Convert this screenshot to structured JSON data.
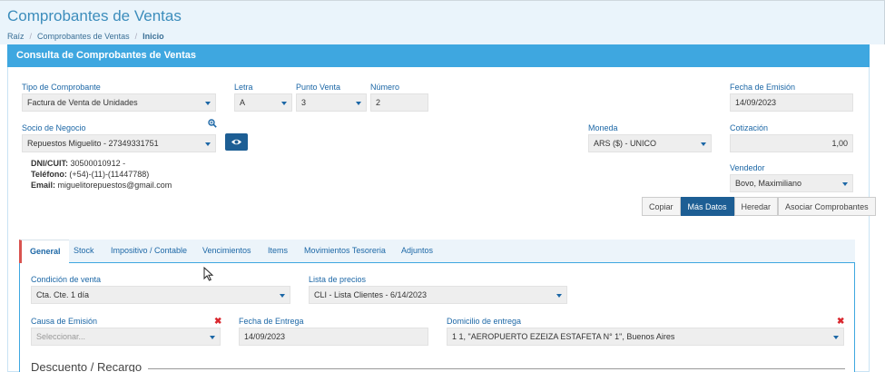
{
  "page": {
    "title": "Comprobantes de Ventas",
    "breadcrumb": [
      "Raíz",
      "Comprobantes de Ventas",
      "Inicio"
    ]
  },
  "panel": {
    "title": "Consulta de Comprobantes de Ventas"
  },
  "form": {
    "tipo_comprobante": {
      "label": "Tipo de Comprobante",
      "value": "Factura de Venta de Unidades"
    },
    "letra": {
      "label": "Letra",
      "value": "A"
    },
    "punto_venta": {
      "label": "Punto Venta",
      "value": "3"
    },
    "numero": {
      "label": "Número",
      "value": "2"
    },
    "fecha_emision": {
      "label": "Fecha de Emisión",
      "value": "14/09/2023"
    },
    "socio_negocio": {
      "label": "Socio de Negocio",
      "value": "Repuestos Miguelito - 27349331751"
    },
    "moneda": {
      "label": "Moneda",
      "value": "ARS ($) - UNICO"
    },
    "cotizacion": {
      "label": "Cotización",
      "value": "1,00"
    },
    "vendedor": {
      "label": "Vendedor",
      "value": "Bovo, Maximiliano"
    }
  },
  "partner_info": {
    "dni_label": "DNI/CUIT:",
    "dni_value": "30500010912 -",
    "tel_label": "Teléfono:",
    "tel_value": "(+54)-(11)-(11447788)",
    "email_label": "Email:",
    "email_value": "miguelitorepuestos@gmail.com"
  },
  "actions": [
    "Copiar",
    "Más Datos",
    "Heredar",
    "Asociar Comprobantes"
  ],
  "tabs": [
    "General",
    "Stock",
    "Impositivo / Contable",
    "Vencimientos",
    "Items",
    "Movimientos Tesoreria",
    "Adjuntos"
  ],
  "general": {
    "condicion_venta": {
      "label": "Condición de venta",
      "value": "Cta. Cte. 1 día"
    },
    "lista_precios": {
      "label": "Lista de precios",
      "value": "CLI - Lista Clientes - 6/14/2023"
    },
    "causa_emision": {
      "label": "Causa de Emisión",
      "placeholder": "Seleccionar..."
    },
    "fecha_entrega": {
      "label": "Fecha de Entrega",
      "value": "14/09/2023"
    },
    "domicilio_entrega": {
      "label": "Domicilio de entrega",
      "value": "1 1, \"AEROPUERTO EZEIZA ESTAFETA N° 1\", Buenos Aires"
    },
    "section_title": "Descuento / Recargo",
    "clear_symbol": "✖"
  },
  "colors": {
    "accent": "#3ea7e0",
    "primary_button": "#1d5e94",
    "label": "#1c67a6",
    "danger": "#d9272e"
  }
}
